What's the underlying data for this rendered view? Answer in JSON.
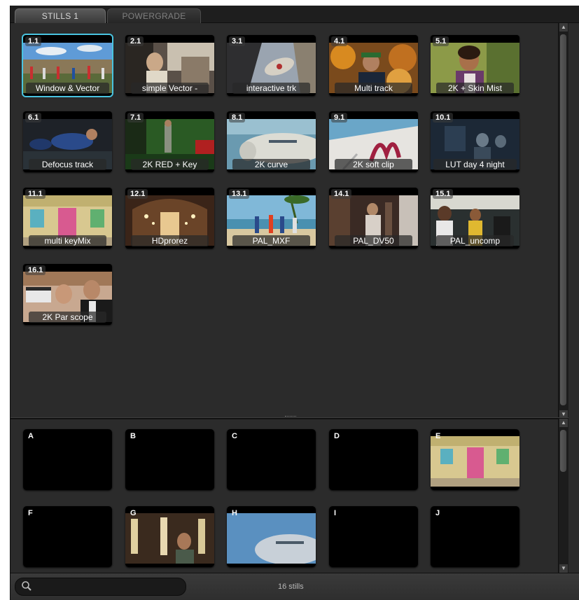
{
  "tabs": [
    {
      "label": "STILLS 1",
      "active": true
    },
    {
      "label": "POWERGRADE",
      "active": false
    }
  ],
  "stills": [
    {
      "index": "1.1",
      "caption": "Window & Vector",
      "selected": true
    },
    {
      "index": "2.1",
      "caption": "simple Vector -"
    },
    {
      "index": "3.1",
      "caption": "interactive trk"
    },
    {
      "index": "4.1",
      "caption": "Multi track"
    },
    {
      "index": "5.1",
      "caption": "2K + Skin Mist"
    },
    {
      "index": "6.1",
      "caption": "Defocus track"
    },
    {
      "index": "7.1",
      "caption": "2K RED + Key"
    },
    {
      "index": "8.1",
      "caption": "2K curve"
    },
    {
      "index": "9.1",
      "caption": "2K soft clip"
    },
    {
      "index": "10.1",
      "caption": "LUT day 4 night"
    },
    {
      "index": "11.1",
      "caption": "multi keyMix"
    },
    {
      "index": "12.1",
      "caption": "HDprorez"
    },
    {
      "index": "13.1",
      "caption": "PAL_MXF"
    },
    {
      "index": "14.1",
      "caption": "PAL_DV50"
    },
    {
      "index": "15.1",
      "caption": "PAL_uncomp"
    },
    {
      "index": "16.1",
      "caption": "2K Par scope"
    }
  ],
  "memories": [
    {
      "label": "A",
      "filled": false
    },
    {
      "label": "B",
      "filled": false
    },
    {
      "label": "C",
      "filled": false
    },
    {
      "label": "D",
      "filled": false
    },
    {
      "label": "E",
      "filled": true
    },
    {
      "label": "F",
      "filled": false
    },
    {
      "label": "G",
      "filled": true
    },
    {
      "label": "H",
      "filled": true
    },
    {
      "label": "I",
      "filled": false
    },
    {
      "label": "J",
      "filled": false
    }
  ],
  "status": {
    "count_text": "16 stills",
    "search_value": ""
  },
  "colors": {
    "selection": "#49c4e0",
    "panel": "#2b2b2b"
  }
}
